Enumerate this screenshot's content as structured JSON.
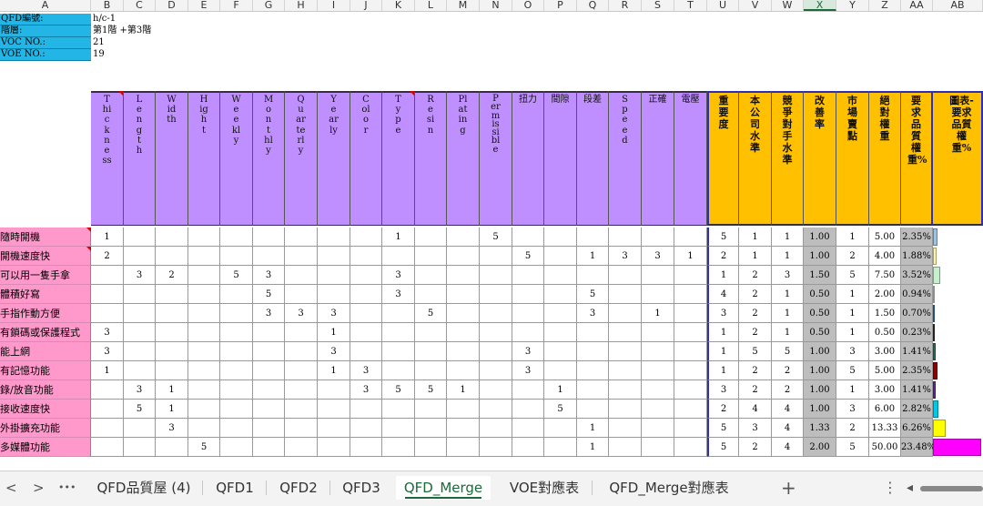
{
  "columns": [
    "A",
    "B",
    "C",
    "D",
    "E",
    "F",
    "G",
    "H",
    "I",
    "J",
    "K",
    "L",
    "M",
    "N",
    "O",
    "P",
    "Q",
    "R",
    "S",
    "T",
    "U",
    "V",
    "W",
    "X",
    "Y",
    "Z",
    "AA",
    "AB"
  ],
  "selected_column": "X",
  "meta": [
    {
      "label": "QFD編號:",
      "value": "h/c-1"
    },
    {
      "label": "階層:",
      "value": "第1階 +第3階"
    },
    {
      "label": "VOC NO.:",
      "value": "21"
    },
    {
      "label": "VOE NO.:",
      "value": "19"
    }
  ],
  "headers_purple": [
    "Thickness",
    "Length",
    "Width",
    "Hight",
    "Weekly",
    "Monthly",
    "Quarterly",
    "Yearly",
    "Color",
    "Type",
    "Resin",
    "Plating",
    "Permissible",
    "扭力",
    "間隙",
    "段差",
    "Speed",
    "正確",
    "電壓"
  ],
  "headers_orange": [
    "重要度",
    "本公司水準",
    "競爭對手水準",
    "改善率",
    "市場賣點",
    "絕對權重",
    "要求品質權重%",
    "圖表-要求品質權重%"
  ],
  "rows": [
    {
      "label": "隨時開機",
      "cells": [
        "1",
        "",
        "",
        "",
        "",
        "",
        "",
        "",
        "",
        "1",
        "",
        "",
        "5",
        "",
        "",
        "",
        "",
        "",
        ""
      ],
      "imp": "5",
      "own": "1",
      "comp": "1",
      "rate": "1.00",
      "sell": "1",
      "abs": "5.00",
      "pct": "2.35%",
      "bar": {
        "value": 2.35,
        "color": "#9cc3e6"
      }
    },
    {
      "label": "開機速度快",
      "cells": [
        "2",
        "",
        "",
        "",
        "",
        "",
        "",
        "",
        "",
        "",
        "",
        "",
        "",
        "5",
        "",
        "1",
        "3",
        "3",
        "1"
      ],
      "imp": "2",
      "own": "1",
      "comp": "1",
      "rate": "1.00",
      "sell": "2",
      "abs": "4.00",
      "pct": "1.88%",
      "bar": {
        "value": 1.88,
        "color": "#fff2a8"
      }
    },
    {
      "label": "可以用一隻手拿",
      "cells": [
        "",
        "3",
        "2",
        "",
        "5",
        "3",
        "",
        "",
        "",
        "3",
        "",
        "",
        "",
        "",
        "",
        "",
        "",
        "",
        ""
      ],
      "imp": "1",
      "own": "2",
      "comp": "3",
      "rate": "1.50",
      "sell": "5",
      "abs": "7.50",
      "pct": "3.52%",
      "bar": {
        "value": 3.52,
        "color": "#c6efce"
      }
    },
    {
      "label": "體積好寫",
      "cells": [
        "",
        "",
        "",
        "",
        "",
        "5",
        "",
        "",
        "",
        "3",
        "",
        "",
        "",
        "",
        "",
        "5",
        "",
        "",
        ""
      ],
      "imp": "4",
      "own": "2",
      "comp": "1",
      "rate": "0.50",
      "sell": "1",
      "abs": "2.00",
      "pct": "0.94%",
      "bar": {
        "value": 0.94,
        "color": "#d9d9d9"
      }
    },
    {
      "label": "手指作動方便",
      "cells": [
        "",
        "",
        "",
        "",
        "",
        "3",
        "3",
        "3",
        "",
        "",
        "5",
        "",
        "",
        "",
        "",
        "3",
        "",
        "1",
        ""
      ],
      "imp": "3",
      "own": "2",
      "comp": "1",
      "rate": "0.50",
      "sell": "1",
      "abs": "1.50",
      "pct": "0.70%",
      "bar": {
        "value": 0.7,
        "color": "#3a7ab8"
      }
    },
    {
      "label": "有鎖碼或保護程式",
      "cells": [
        "3",
        "",
        "",
        "",
        "",
        "",
        "",
        "1",
        "",
        "",
        "",
        "",
        "",
        "",
        "",
        "",
        "",
        "",
        ""
      ],
      "imp": "1",
      "own": "2",
      "comp": "1",
      "rate": "0.50",
      "sell": "1",
      "abs": "0.50",
      "pct": "0.23%",
      "bar": {
        "value": 0.23,
        "color": "#333333"
      }
    },
    {
      "label": "能上網",
      "cells": [
        "3",
        "",
        "",
        "",
        "",
        "",
        "",
        "3",
        "",
        "",
        "",
        "",
        "",
        "3",
        "",
        "",
        "",
        "",
        ""
      ],
      "imp": "1",
      "own": "5",
      "comp": "5",
      "rate": "1.00",
      "sell": "3",
      "abs": "3.00",
      "pct": "1.41%",
      "bar": {
        "value": 1.41,
        "color": "#2e6b5e"
      }
    },
    {
      "label": "有記憶功能",
      "cells": [
        "1",
        "",
        "",
        "",
        "",
        "",
        "",
        "1",
        "3",
        "",
        "",
        "",
        "",
        "3",
        "",
        "",
        "",
        "",
        ""
      ],
      "imp": "1",
      "own": "2",
      "comp": "2",
      "rate": "1.00",
      "sell": "5",
      "abs": "5.00",
      "pct": "2.35%",
      "bar": {
        "value": 2.35,
        "color": "#8b0000"
      }
    },
    {
      "label": "錄/放音功能",
      "cells": [
        "",
        "3",
        "1",
        "",
        "",
        "",
        "",
        "",
        "3",
        "5",
        "5",
        "1",
        "",
        "",
        "1",
        "",
        "",
        "",
        ""
      ],
      "imp": "3",
      "own": "2",
      "comp": "2",
      "rate": "1.00",
      "sell": "1",
      "abs": "3.00",
      "pct": "1.41%",
      "bar": {
        "value": 1.41,
        "color": "#5b2c91"
      }
    },
    {
      "label": "接收速度快",
      "cells": [
        "",
        "5",
        "1",
        "",
        "",
        "",
        "",
        "",
        "",
        "",
        "",
        "",
        "",
        "",
        "5",
        "",
        "",
        "",
        ""
      ],
      "imp": "2",
      "own": "4",
      "comp": "4",
      "rate": "1.00",
      "sell": "3",
      "abs": "6.00",
      "pct": "2.82%",
      "bar": {
        "value": 2.82,
        "color": "#00c8e6"
      }
    },
    {
      "label": "外掛擴充功能",
      "cells": [
        "",
        "",
        "3",
        "",
        "",
        "",
        "",
        "",
        "",
        "",
        "",
        "",
        "",
        "",
        "",
        "1",
        "",
        "",
        ""
      ],
      "imp": "5",
      "own": "3",
      "comp": "4",
      "rate": "1.33",
      "sell": "2",
      "abs": "13.33",
      "pct": "6.26%",
      "bar": {
        "value": 6.26,
        "color": "#ffff00"
      }
    },
    {
      "label": "多媒體功能",
      "cells": [
        "",
        "",
        "",
        "5",
        "",
        "",
        "",
        "",
        "",
        "",
        "",
        "",
        "",
        "",
        "",
        "1",
        "",
        "",
        ""
      ],
      "imp": "5",
      "own": "2",
      "comp": "4",
      "rate": "2.00",
      "sell": "5",
      "abs": "50.00",
      "pct": "23.48%",
      "bar": {
        "value": 23.48,
        "color": "#ff00ff"
      }
    }
  ],
  "tabs": [
    "QFD品質屋 (4)",
    "QFD1",
    "QFD2",
    "QFD3",
    "QFD_Merge",
    "VOE對應表",
    "QFD_Merge對應表"
  ],
  "active_tab": "QFD_Merge",
  "nav": {
    "prev": "<",
    "next": ">",
    "more": "•••",
    "add": "+",
    "menu": "⋮",
    "scroll_left": "◂"
  }
}
